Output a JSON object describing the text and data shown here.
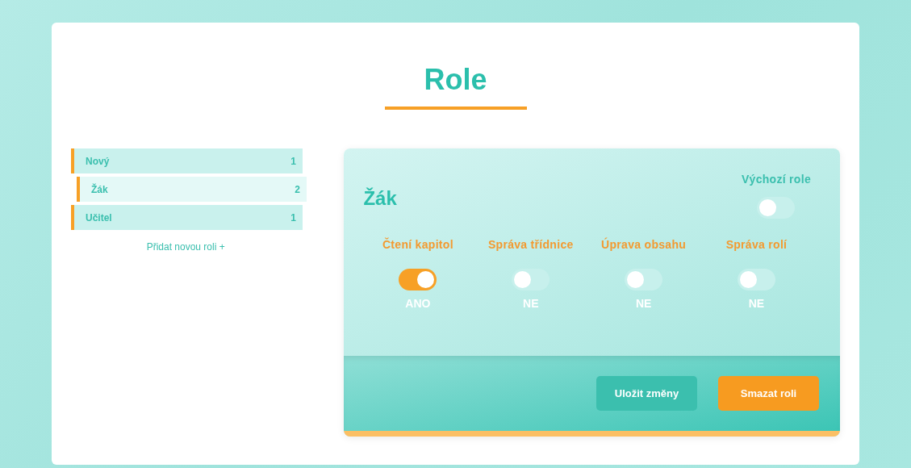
{
  "title": "Role",
  "roles": [
    {
      "name": "Nový",
      "count": "1",
      "selected": false
    },
    {
      "name": "Žák",
      "count": "2",
      "selected": true
    },
    {
      "name": "Učitel",
      "count": "1",
      "selected": false
    }
  ],
  "add_role_link": "Přidat novou roli +",
  "detail": {
    "title": "Žák",
    "default_role": {
      "label": "Výchozí role",
      "on": false
    },
    "permissions": [
      {
        "label": "Čtení kapitol",
        "on": true,
        "state_text": "ANO"
      },
      {
        "label": "Správa třídnice",
        "on": false,
        "state_text": "NE"
      },
      {
        "label": "Úprava obsahu",
        "on": false,
        "state_text": "NE"
      },
      {
        "label": "Správa rolí",
        "on": false,
        "state_text": "NE"
      }
    ],
    "buttons": [
      {
        "label": "Uložit změny",
        "kind": "save"
      },
      {
        "label": "Smazat roli",
        "kind": "delete"
      }
    ]
  }
}
